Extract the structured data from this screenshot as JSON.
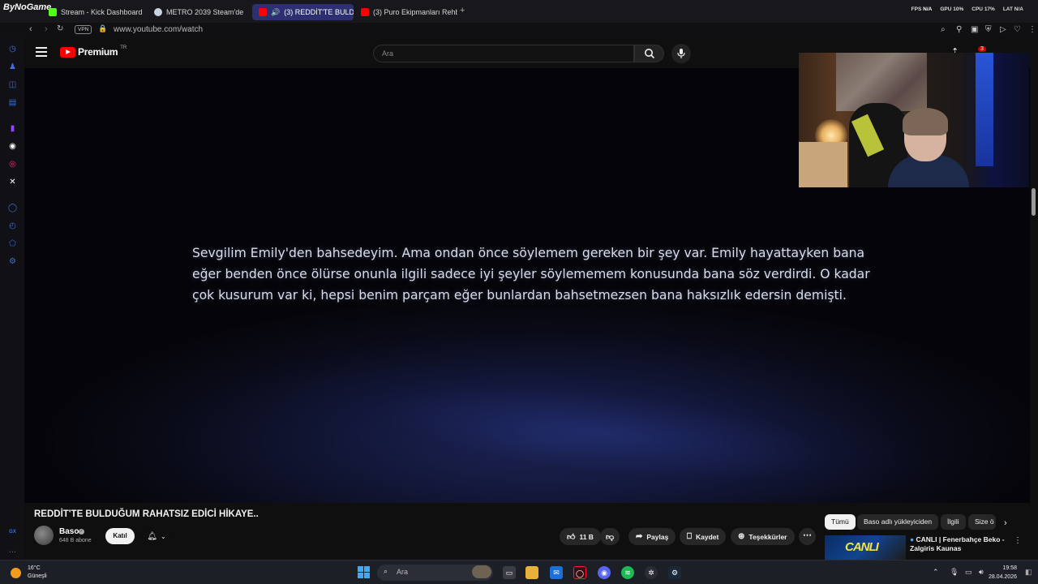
{
  "overlay": {
    "brand": "ByNoGame"
  },
  "browser": {
    "tabs": [
      {
        "label": "Stream - Kick Dashboard",
        "color": "#53fc18"
      },
      {
        "label": "METRO 2039 Steam'de",
        "color": "#c6d4df"
      },
      {
        "label": "(3) REDDİT'TE BULDU",
        "color": "#ff0000",
        "active": true
      },
      {
        "label": "(3) Puro Ekipmanları Rehbe",
        "color": "#ff0000"
      }
    ],
    "new_tab": "+",
    "stats": {
      "fps_label": "FPS",
      "fps": "N/A",
      "gpu_label": "GPU",
      "gpu": "10%",
      "cpu_label": "CPU",
      "cpu": "17%",
      "lat_label": "LAT",
      "lat": "N/A"
    },
    "vpn": "VPN",
    "url": "www.youtube.com/watch"
  },
  "youtube": {
    "logo_text": "Premium",
    "logo_region": "TR",
    "search_placeholder": "Ara",
    "notifications_count": "3",
    "video": {
      "subtitle": "Sevgilim Emily'den bahsedeyim. Ama ondan önce söylemem gereken bir şey var. Emily hayattayken bana eğer benden önce ölürse onunla ilgili sadece iyi şeyler söylememem konusunda bana söz verdirdi. O kadar çok kusurum var ki, hepsi benim parçam eğer bunlardan bahsetmezsen bana haksızlık edersin demişti."
    },
    "title": "REDDİT'TE BULDUĞUM RAHATSIZ EDİCİ HİKAYE..",
    "channel": {
      "name": "Baso",
      "subscribers": "648 B abone"
    },
    "join_label": "Katıl",
    "actions": {
      "like_count": "11 B",
      "share": "Paylaş",
      "save": "Kaydet",
      "thanks": "Teşekkürler"
    },
    "chips": [
      "Tümü",
      "Baso adlı yükleyiciden",
      "İlgili",
      "Size ö"
    ],
    "recommended": {
      "thumb_text": "CANLI",
      "title": "CANLI | Fenerbahçe Beko - Zalgiris Kaunas"
    }
  },
  "sidebar_label": "GX",
  "taskbar": {
    "weather_temp": "16°C",
    "weather_desc": "Güneşli",
    "search_placeholder": "Ara",
    "time": "19:58",
    "date": "28.04.2026"
  }
}
